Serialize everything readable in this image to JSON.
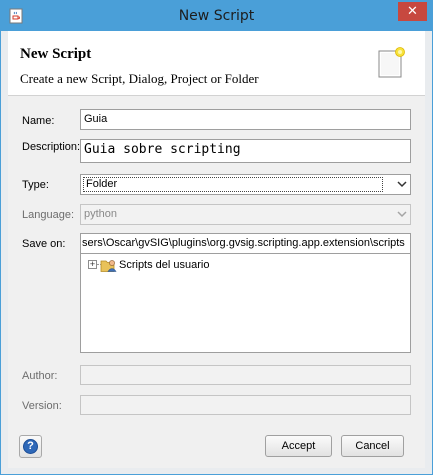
{
  "window": {
    "title": "New Script",
    "close_glyph": "✕",
    "app_icon": "java-cup-icon"
  },
  "header": {
    "title": "New Script",
    "subtitle": "Create a new Script, Dialog, Project or Folder",
    "icon": "document-icon"
  },
  "form": {
    "name": {
      "label": "Name:",
      "value": "Guia"
    },
    "description": {
      "label": "Description:",
      "value": "Guia sobre scripting"
    },
    "type": {
      "label": "Type:",
      "value": "Folder"
    },
    "language": {
      "label": "Language:",
      "value": "python"
    },
    "save_on": {
      "label": "Save on:",
      "value": "sers\\Oscar\\gvSIG\\plugins\\org.gvsig.scripting.app.extension\\scripts",
      "tree": [
        {
          "label": "Scripts del usuario",
          "expander": "+",
          "icon": "user-folder-icon"
        }
      ]
    },
    "author": {
      "label": "Author:",
      "value": ""
    },
    "version": {
      "label": "Version:",
      "value": ""
    }
  },
  "footer": {
    "help_glyph": "?",
    "accept_label": "Accept",
    "cancel_label": "Cancel"
  },
  "colors": {
    "titlebar": "#4a9fd8",
    "close": "#c7483f",
    "help": "#2e68b8"
  }
}
